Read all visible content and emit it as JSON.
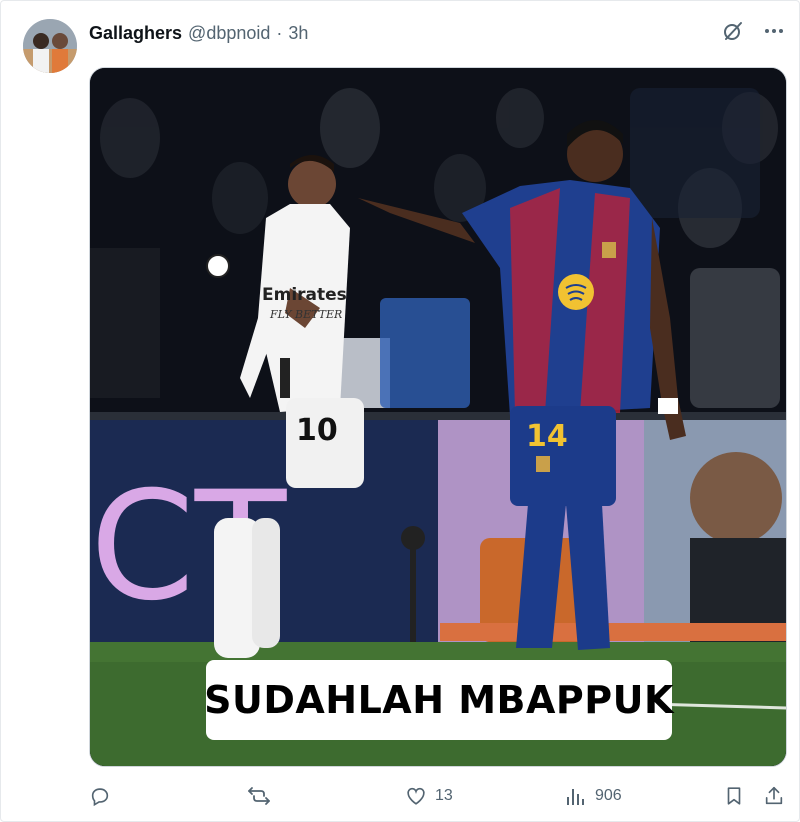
{
  "post": {
    "author": {
      "display_name": "Gallaghers",
      "handle": "@dbpnoid",
      "separator": "·",
      "time": "3h"
    },
    "top_icons": [
      "grok-icon",
      "more-icon"
    ],
    "media": {
      "caption": "SUDAHLAH MBAPPUK",
      "jersey_left_number": "10",
      "jersey_left_sponsor": "Emirates",
      "jersey_left_sponsor_sub": "FLY BETTER",
      "jersey_right_number": "14",
      "board_text": "CT",
      "colors": {
        "barca_blue": "#1f3f8f",
        "barca_red": "#b0233d",
        "barca_yellow": "#f1c232",
        "pitch": "#3d6b2f"
      }
    },
    "actions": {
      "reply": {
        "icon": "reply-icon",
        "count": ""
      },
      "repost": {
        "icon": "repost-icon",
        "count": ""
      },
      "like": {
        "icon": "heart-icon",
        "count": "13"
      },
      "views": {
        "icon": "views-icon",
        "count": "906"
      },
      "bookmark": {
        "icon": "bookmark-icon"
      },
      "share": {
        "icon": "share-icon"
      }
    }
  }
}
